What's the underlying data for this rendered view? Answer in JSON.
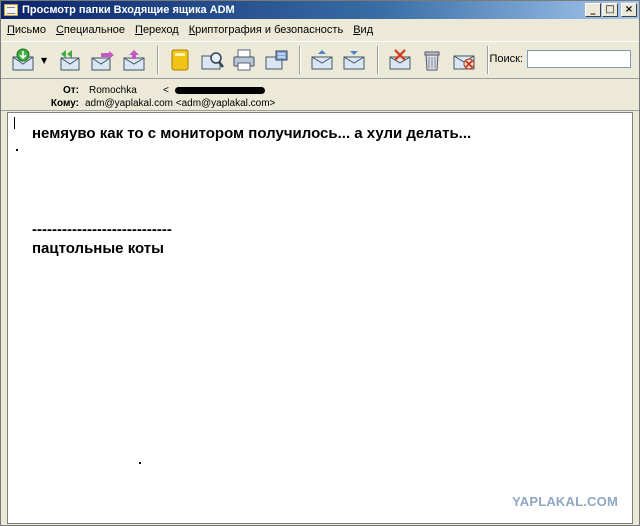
{
  "window": {
    "title": "Просмотр папки Входящие ящика ADM",
    "minimize_glyph": "_",
    "maximize_glyph": "□",
    "close_glyph": "×"
  },
  "menu": {
    "items": [
      {
        "u": "П",
        "rest": "исьмо"
      },
      {
        "u": "С",
        "rest": "пециальное"
      },
      {
        "u": "П",
        "rest": "ереход"
      },
      {
        "u": "К",
        "rest": "риптография и безопасность"
      },
      {
        "u": "В",
        "rest": "ид"
      }
    ]
  },
  "toolbar": {
    "icons": [
      "receive-mail-icon",
      "reply-all-icon",
      "forward-icon",
      "send-icon",
      "address-book-icon",
      "find-icon",
      "print-icon",
      "properties-icon",
      "move-up-icon",
      "move-down-icon",
      "delete-icon",
      "trash-icon",
      "spam-icon"
    ],
    "search_label": "Поиск:",
    "search_value": ""
  },
  "header": {
    "from_label": "От:",
    "from_value": "Romochka",
    "from_addr_prefix": "<",
    "to_label": "Кому:",
    "to_value": "adm@yaplakal.com <adm@yaplakal.com>"
  },
  "message": {
    "line1": "немяуво как то с монитором получилось... а хули делать...",
    "separator": "----------------------------",
    "signature": "пацтольные коты"
  },
  "watermark": "YAPLAKAL.COM"
}
